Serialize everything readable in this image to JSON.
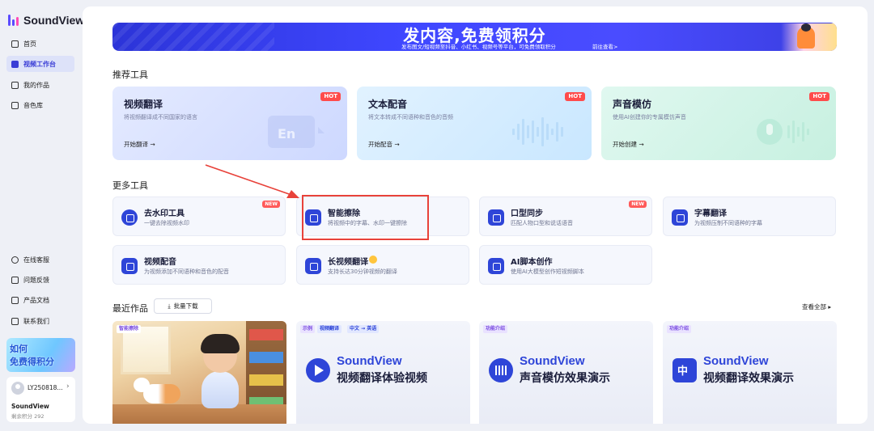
{
  "app": {
    "name": "SoundView"
  },
  "sidebar": {
    "nav": [
      {
        "label": "首页",
        "icon": "home-icon"
      },
      {
        "label": "视频工作台",
        "icon": "video-workbench-icon",
        "active": true
      },
      {
        "label": "我的作品",
        "icon": "works-icon"
      },
      {
        "label": "音色库",
        "icon": "voice-library-icon"
      }
    ],
    "bottom_nav": [
      {
        "label": "在线客服",
        "icon": "headset-icon"
      },
      {
        "label": "问题反馈",
        "icon": "feedback-icon"
      },
      {
        "label": "产品文档",
        "icon": "document-icon"
      },
      {
        "label": "联系我们",
        "icon": "qrcode-icon"
      }
    ],
    "promo": {
      "line1": "如何",
      "line2": "免费得积分"
    },
    "user": {
      "name": "LY250818...",
      "plan": "SoundView",
      "points": "剩余积分 292"
    }
  },
  "banner": {
    "title": "发内容,免费领积分",
    "subtitle": "发布图文/短视频至抖音、小红书、视频号等平台，可免费领取积分",
    "link": "前往查看>"
  },
  "recommended": {
    "title": "推荐工具",
    "cards": [
      {
        "title": "视频翻译",
        "desc": "将视频翻译成不同国家的语言",
        "link": "开始翻译 →",
        "badge": "HOT",
        "color": "#dfe7ff"
      },
      {
        "title": "文本配音",
        "desc": "将文本转成不同语种和音色的音频",
        "link": "开始配音 →",
        "badge": "HOT",
        "color": "#dcf1ff"
      },
      {
        "title": "声音模仿",
        "desc": "使用AI创建你的专属模仿声音",
        "link": "开始创建 →",
        "badge": "HOT",
        "color": "#dcf8ef"
      }
    ]
  },
  "more_tools": {
    "title": "更多工具",
    "items": [
      {
        "title": "去水印工具",
        "desc": "一键去除视频水印",
        "badge": "NEW",
        "icon": "download-circle-icon"
      },
      {
        "title": "智能擦除",
        "desc": "将视频中的字幕、水印一键擦除",
        "badge": "",
        "icon": "text-erase-icon"
      },
      {
        "title": "口型同步",
        "desc": "匹配人物口型和说话语音",
        "badge": "NEW",
        "icon": "lip-sync-icon"
      },
      {
        "title": "字幕翻译",
        "desc": "为视频压制不同语种的字幕",
        "badge": "",
        "icon": "subtitle-translate-icon"
      },
      {
        "title": "视频配音",
        "desc": "为视频添加不同语种和音色的配音",
        "badge": "",
        "icon": "video-dubbing-icon"
      },
      {
        "title": "长视频翻译",
        "desc": "支持长达30分钟视频的翻译",
        "badge": "",
        "icon": "long-video-icon"
      },
      {
        "title": "AI脚本创作",
        "desc": "使用AI大模型创作短视频脚本",
        "badge": "",
        "icon": "ai-script-icon"
      }
    ]
  },
  "recent": {
    "title": "最近作品",
    "batch_download": "批量下载",
    "view_all": "查看全部",
    "works": [
      {
        "tags": [
          "智能擦除"
        ]
      },
      {
        "tags": [
          "示例",
          "视频翻译",
          "中文 → 英语"
        ],
        "brand": "SoundView",
        "name": "视频翻译体验视频"
      },
      {
        "tags": [
          "功能介绍"
        ],
        "brand": "SoundView",
        "name": "声音模仿效果演示"
      },
      {
        "tags": [
          "功能介绍"
        ],
        "brand": "SoundView",
        "name": "视频翻译效果演示"
      }
    ]
  },
  "colors": {
    "accent": "#3a3dd6",
    "hot": "#ff4b4b",
    "highlight": "#e8423a"
  }
}
